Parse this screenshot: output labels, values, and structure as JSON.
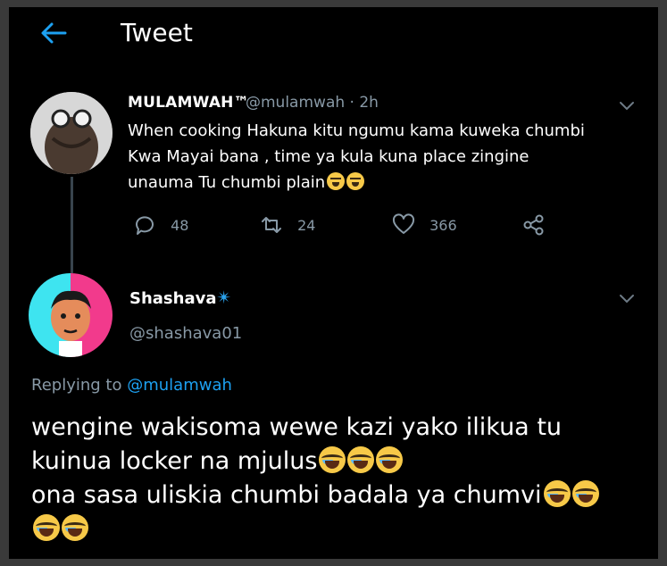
{
  "header": {
    "title": "Tweet"
  },
  "tweet": {
    "name": "MULAMWAH™",
    "meta": "@mulamwah · 2h",
    "lines": [
      "When cooking Hakuna kitu ngumu kama kuweka chumbi",
      "Kwa Mayai bana , time ya kula kuna place zingine",
      "unauma Tu chumbi plain"
    ],
    "stats": {
      "replies": "48",
      "retweets": "24",
      "likes": "366"
    }
  },
  "reply": {
    "name": "Shashava",
    "star": "✴",
    "handle": "@shashava01",
    "replying_prefix": "Replying to",
    "replying_handle": "@mulamwah",
    "lines": [
      "wengine wakisoma wewe kazi yako ilikua tu",
      "kuinua locker na mjulus",
      "ona sasa uliskia chumbi badala ya chumvi"
    ]
  },
  "icons": {
    "back": "arrow-left-icon",
    "caret": "chevron-down-icon",
    "reply": "speech-bubble-icon",
    "retweet": "retweet-icon",
    "like": "heart-icon",
    "share": "share-icon"
  },
  "colors": {
    "accent": "#1da1f2",
    "muted": "#8899a6",
    "background": "#000000"
  }
}
